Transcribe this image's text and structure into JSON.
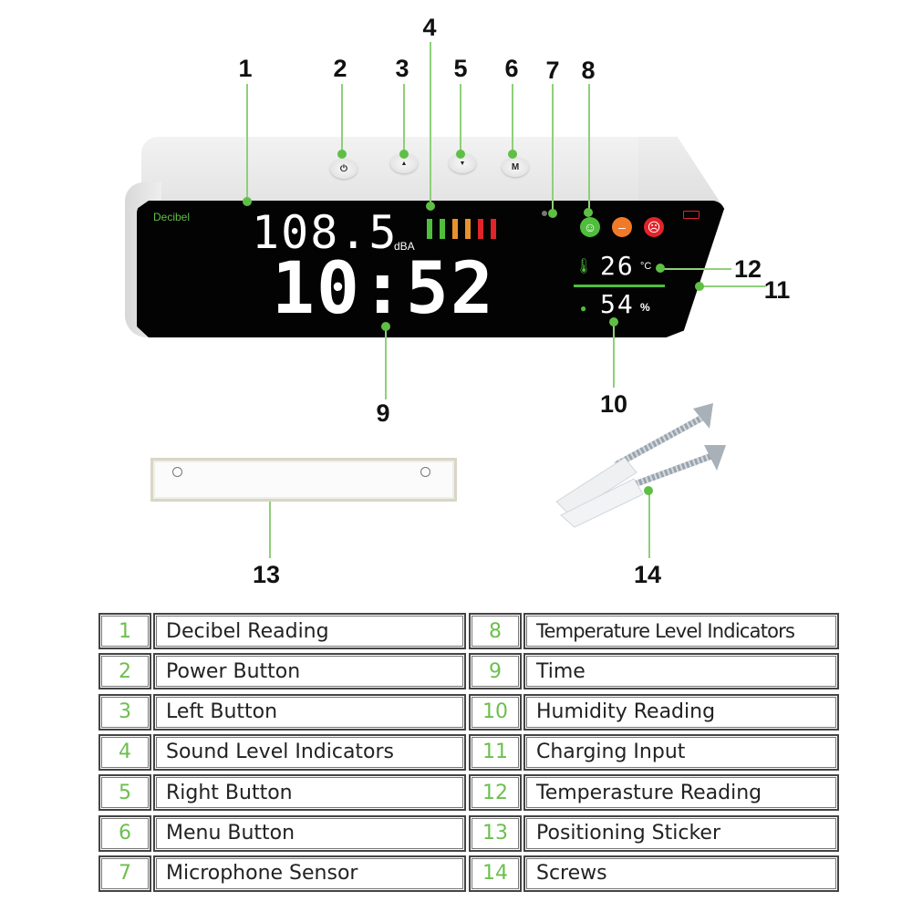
{
  "device": {
    "screen_label": "Decibel",
    "decibel_value": "108.5",
    "decibel_unit": "dBA",
    "time": "10:52",
    "temperature_value": "26",
    "temperature_unit": "°C",
    "humidity_value": "54",
    "humidity_unit": "%",
    "buttons": [
      {
        "name": "power",
        "glyph": "⏻"
      },
      {
        "name": "left",
        "glyph": "▲"
      },
      {
        "name": "right",
        "glyph": "▼"
      },
      {
        "name": "menu",
        "glyph": "M"
      }
    ],
    "sound_level_bars": [
      {
        "color": "#4fbe3c"
      },
      {
        "color": "#4fbe3c"
      },
      {
        "color": "#e8922d"
      },
      {
        "color": "#e8922d"
      },
      {
        "color": "#e0242a"
      },
      {
        "color": "#e0242a"
      }
    ],
    "level_faces": [
      {
        "mood": "happy",
        "glyph": "☺",
        "color": "#4fbe3c"
      },
      {
        "mood": "neutral",
        "glyph": "😐",
        "color": "#f07a2a"
      },
      {
        "mood": "sad",
        "glyph": "☹",
        "color": "#e0242a"
      }
    ],
    "accent_color": "#5fbf45"
  },
  "callouts": [
    "1",
    "2",
    "3",
    "4",
    "5",
    "6",
    "7",
    "8",
    "9",
    "10",
    "11",
    "12",
    "13",
    "14"
  ],
  "legend": {
    "left": [
      {
        "num": "1",
        "label": "Decibel Reading"
      },
      {
        "num": "2",
        "label": "Power Button"
      },
      {
        "num": "3",
        "label": "Left Button"
      },
      {
        "num": "4",
        "label": "Sound Level Indicators"
      },
      {
        "num": "5",
        "label": "Right Button"
      },
      {
        "num": "6",
        "label": "Menu Button"
      },
      {
        "num": "7",
        "label": "Microphone Sensor"
      }
    ],
    "right": [
      {
        "num": "8",
        "label": "Temperature Level Indicators"
      },
      {
        "num": "9",
        "label": "Time"
      },
      {
        "num": "10",
        "label": "Humidity Reading"
      },
      {
        "num": "11",
        "label": "Charging Input"
      },
      {
        "num": "12",
        "label": "Temperasture Reading"
      },
      {
        "num": "13",
        "label": "Positioning Sticker"
      },
      {
        "num": "14",
        "label": "Screws"
      }
    ]
  }
}
